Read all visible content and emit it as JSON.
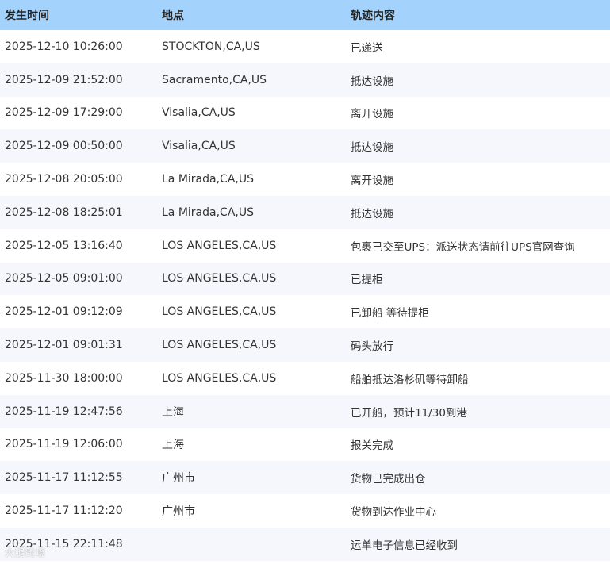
{
  "table": {
    "headers": {
      "time": "发生时间",
      "location": "地点",
      "content": "轨迹内容"
    },
    "rows": [
      {
        "time": "2025-12-10 10:26:00",
        "location": "STOCKTON,CA,US",
        "content": "已递送"
      },
      {
        "time": "2025-12-09 21:52:00",
        "location": "Sacramento,CA,US",
        "content": "抵达设施"
      },
      {
        "time": "2025-12-09 17:29:00",
        "location": "Visalia,CA,US",
        "content": "离开设施"
      },
      {
        "time": "2025-12-09 00:50:00",
        "location": "Visalia,CA,US",
        "content": "抵达设施"
      },
      {
        "time": "2025-12-08 20:05:00",
        "location": "La Mirada,CA,US",
        "content": "离开设施"
      },
      {
        "time": "2025-12-08 18:25:01",
        "location": "La Mirada,CA,US",
        "content": "抵达设施"
      },
      {
        "time": "2025-12-05 13:16:40",
        "location": "LOS ANGELES,CA,US",
        "content": "包裹已交至UPS：派送状态请前往UPS官网查询"
      },
      {
        "time": "2025-12-05 09:01:00",
        "location": "LOS ANGELES,CA,US",
        "content": "已提柜"
      },
      {
        "time": "2025-12-01 09:12:09",
        "location": "LOS ANGELES,CA,US",
        "content": "已卸船 等待提柜"
      },
      {
        "time": "2025-12-01 09:01:31",
        "location": "LOS ANGELES,CA,US",
        "content": "码头放行"
      },
      {
        "time": "2025-11-30 18:00:00",
        "location": "LOS ANGELES,CA,US",
        "content": "船舶抵达洛杉矶等待卸船"
      },
      {
        "time": "2025-11-19 12:47:56",
        "location": "上海",
        "content": "已开船，预计11/30到港"
      },
      {
        "time": "2025-11-19 12:06:00",
        "location": "上海",
        "content": "报关完成"
      },
      {
        "time": "2025-11-17 11:12:55",
        "location": "广州市",
        "content": "货物已完成出仓"
      },
      {
        "time": "2025-11-17 11:12:20",
        "location": "广州市",
        "content": "货物到达作业中心"
      },
      {
        "time": "2025-11-15 22:11:48",
        "location": "",
        "content": "运单电子信息已经收到"
      }
    ]
  },
  "watermark": "大腿跨境",
  "colors": {
    "header_bg": "#a3d2fc",
    "row_alt_bg": "#f5f7fc",
    "text": "#333333"
  }
}
